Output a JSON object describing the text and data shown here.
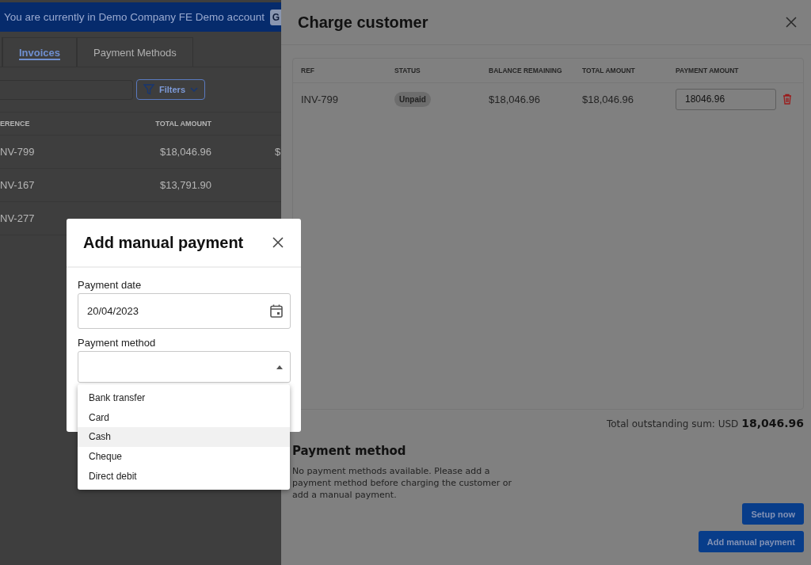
{
  "banner": {
    "text": "You are currently in Demo Company FE Demo account",
    "button": "G"
  },
  "tabs": [
    {
      "label": "Invoices",
      "selected": true
    },
    {
      "label": "Payment Methods",
      "selected": false
    }
  ],
  "filters_button": "Filters",
  "invoices_table": {
    "columns": [
      "ERENCE",
      "TOTAL AMOUNT"
    ],
    "rows": [
      [
        "NV-799",
        "$18,046.96",
        "$"
      ],
      [
        "NV-167",
        "$13,791.90"
      ],
      [
        "NV-277"
      ]
    ]
  },
  "charge_panel": {
    "title": "Charge customer",
    "table": {
      "columns": [
        "REF",
        "STATUS",
        "BALANCE REMAINING",
        "TOTAL AMOUNT",
        "PAYMENT AMOUNT"
      ],
      "rows": [
        {
          "ref": "INV-799",
          "status": "Unpaid",
          "balance": "$18,046.96",
          "total": "$18,046.96",
          "payment_amount": "18046.96"
        }
      ]
    },
    "total": {
      "label": "Total outstanding sum: USD",
      "amount": "18,046.96"
    },
    "payment_method": {
      "heading": "Payment method",
      "message": "No payment methods available. Please add a payment method before charging the customer or add a manual payment."
    },
    "buttons": [
      "Setup now",
      "Add manual payment"
    ]
  },
  "modal": {
    "title": "Add manual payment",
    "fields": [
      {
        "kind": "date",
        "label": "Payment date",
        "value": "20/04/2023"
      },
      {
        "kind": "select",
        "label": "Payment method",
        "expanded": true
      }
    ],
    "options": [
      {
        "label": "Bank transfer",
        "selected": false
      },
      {
        "label": "Card",
        "selected": false
      },
      {
        "label": "Cash",
        "selected": true
      },
      {
        "label": "Cheque",
        "selected": false
      },
      {
        "label": "Direct debit",
        "selected": false
      }
    ]
  }
}
